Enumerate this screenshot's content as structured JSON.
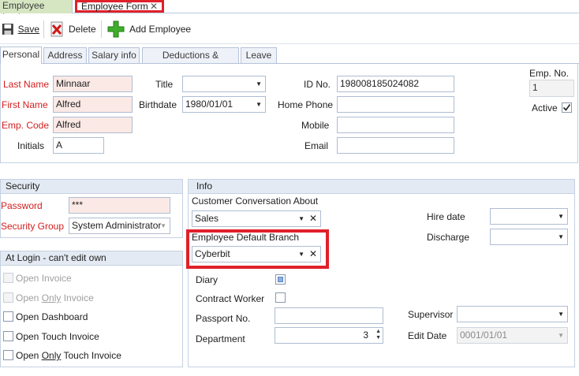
{
  "doc_tabs": {
    "lookup": "Employee Lookup",
    "form": "Employee Form"
  },
  "toolbar": {
    "save": "Save",
    "delete": "Delete",
    "add": "Add Employee"
  },
  "tabs": [
    "Personal",
    "Address",
    "Salary info",
    "Deductions & Earnings",
    "Leave"
  ],
  "personal": {
    "last_name_label": "Last Name",
    "last_name": "Minnaar",
    "first_name_label": "First Name",
    "first_name": "Alfred",
    "emp_code_label": "Emp. Code",
    "emp_code": "Alfred",
    "initials_label": "Initials",
    "initials": "A",
    "title_label": "Title",
    "title": "",
    "birthdate_label": "Birthdate",
    "birthdate": "1980/01/01",
    "id_label": "ID No.",
    "id_no": "1980081850240 82",
    "home_phone_label": "Home Phone",
    "home_phone": "",
    "mobile_label": "Mobile",
    "mobile": "",
    "email_label": "Email",
    "email": "",
    "emp_no_label": "Emp. No.",
    "emp_no": "1",
    "active_label": "Active"
  },
  "security": {
    "header": "Security",
    "password_label": "Password",
    "password": "***",
    "group_label": "Security Group",
    "group": "System Administrator"
  },
  "login": {
    "header": "At Login - can't edit own",
    "open_invoice": "Open Invoice",
    "open_only_invoice_pre": "Open ",
    "open_only_invoice_only": "Only",
    "open_only_invoice_post": " Invoice",
    "open_dashboard": "Open Dashboard",
    "open_touch_invoice": "Open Touch Invoice",
    "open_only_touch_pre": "Open ",
    "open_only_touch_only": "Only",
    "open_only_touch_post": " Touch Invoice"
  },
  "info": {
    "header": "Info",
    "conv_label": "Customer Conversation About",
    "conv": "Sales",
    "branch_label": "Employee Default Branch",
    "branch": "Cyberbit",
    "diary_label": "Diary",
    "contract_label": "Contract Worker",
    "passport_label": "Passport No.",
    "passport": "",
    "department_label": "Department",
    "department": "3",
    "hire_label": "Hire date",
    "hire": "",
    "discharge_label": "Discharge",
    "discharge": "",
    "supervisor_label": "Supervisor",
    "supervisor": "",
    "edit_date_label": "Edit Date",
    "edit_date": "0001/01/01"
  }
}
